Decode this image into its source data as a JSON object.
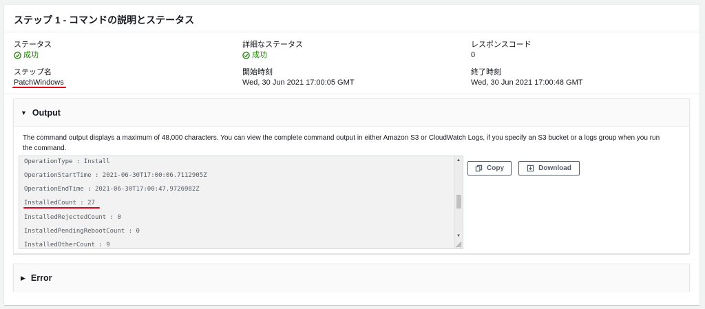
{
  "header": {
    "title": "ステップ 1 - コマンドの説明とステータス"
  },
  "details": {
    "status": {
      "label": "ステータス",
      "value": "成功"
    },
    "detailed_status": {
      "label": "詳細なステータス",
      "value": "成功"
    },
    "response_code": {
      "label": "レスポンスコード",
      "value": "0"
    },
    "step_name": {
      "label": "ステップ名",
      "value": "PatchWindows"
    },
    "start_time": {
      "label": "開始時刻",
      "value": "Wed, 30 Jun 2021 17:00:05 GMT"
    },
    "end_time": {
      "label": "終了時刻",
      "value": "Wed, 30 Jun 2021 17:00:48 GMT"
    }
  },
  "output": {
    "title": "Output",
    "description": "The command output displays a maximum of 48,000 characters. You can view the complete command output in either Amazon S3 or CloudWatch Logs, if you specify an S3 bucket or a logs group when you run the command.",
    "lines": [
      "OperationType : Install",
      "OperationStartTime : 2021-06-30T17:00:06.7112905Z",
      "OperationEndTime : 2021-06-30T17:00:47.9726982Z",
      "InstalledCount : 27",
      "InstalledRejectedCount : 0",
      "InstalledPendingRebootCount : 0",
      "InstalledOtherCount : 9"
    ],
    "copy_label": "Copy",
    "download_label": "Download"
  },
  "error": {
    "title": "Error"
  },
  "colors": {
    "success": "#1d8102",
    "annotation": "#e3001b"
  },
  "icons": {
    "status": "check-circle-icon",
    "copy": "copy-icon",
    "download": "download-icon"
  }
}
